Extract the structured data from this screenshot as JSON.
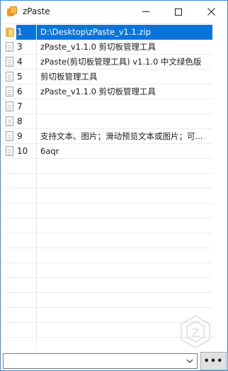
{
  "window": {
    "title": "zPaste",
    "minimize_icon": "minimize-icon",
    "maximize_icon": "maximize-icon",
    "close_icon": "close-icon",
    "border_color": "#3a8fd8"
  },
  "list": {
    "selected_color": "#0a74da",
    "rows": [
      {
        "num": "1",
        "text": "D:\\Desktop\\zPaste_v1.1.zip",
        "icon": "folder-icon",
        "selected": true
      },
      {
        "num": "3",
        "text": "zPaste_v1.1.0 剪切板管理工具",
        "icon": "text-file-icon",
        "selected": false
      },
      {
        "num": "4",
        "text": "zPaste(剪切板管理工具) v1.1.0 中文绿色版",
        "icon": "text-file-icon",
        "selected": false
      },
      {
        "num": "5",
        "text": "剪切板管理工具",
        "icon": "text-file-icon",
        "selected": false
      },
      {
        "num": "6",
        "text": "zPaste_v1.1.0 剪切板管理工具",
        "icon": "text-file-icon",
        "selected": false
      },
      {
        "num": "7",
        "text": "",
        "icon": "text-file-icon",
        "selected": false
      },
      {
        "num": "8",
        "text": "",
        "icon": "text-file-icon",
        "selected": false
      },
      {
        "num": "9",
        "text": "支持文本、图片；滑动预览文本或图片；可...",
        "icon": "text-file-icon",
        "selected": false
      },
      {
        "num": "10",
        "text": "6aqr",
        "icon": "text-file-icon",
        "selected": false
      }
    ]
  },
  "bottom": {
    "combo_value": "",
    "more_button_label": "•••"
  }
}
